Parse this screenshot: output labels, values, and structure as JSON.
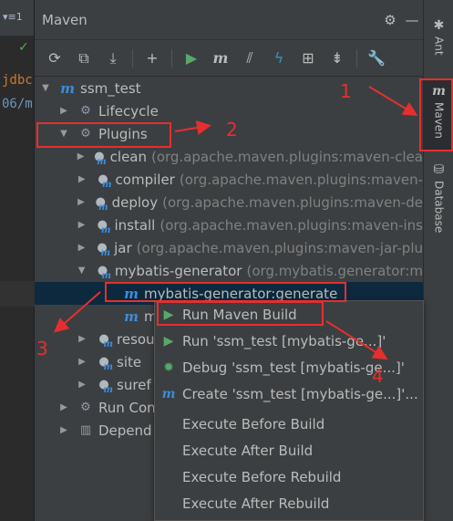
{
  "editor": {
    "top_text": "▾≡1",
    "code_lines": [
      "jdbc",
      "06/m"
    ]
  },
  "panel": {
    "title": "Maven",
    "settings_icon": "gear-icon",
    "hide_icon": "minimize-icon"
  },
  "toolbar": {
    "buttons": [
      {
        "name": "reload-icon",
        "glyph": "⟳"
      },
      {
        "name": "add-folder-icon",
        "glyph": "⧉"
      },
      {
        "name": "download-icon",
        "glyph": "⤓"
      },
      {
        "name": "add-icon",
        "glyph": "+"
      },
      {
        "name": "run-icon",
        "glyph": "▶"
      },
      {
        "name": "maven-goal-icon",
        "glyph": "m"
      },
      {
        "name": "toggle-offline-icon",
        "glyph": "⫽"
      },
      {
        "name": "skip-tests-icon",
        "glyph": "ϟ"
      },
      {
        "name": "show-dependencies-icon",
        "glyph": "⊞"
      },
      {
        "name": "collapse-all-icon",
        "glyph": "⇟"
      },
      {
        "name": "settings-wrench-icon",
        "glyph": "🔧"
      }
    ]
  },
  "tree": {
    "project": "ssm_test",
    "lifecycle": "Lifecycle",
    "plugins": "Plugins",
    "plugin_items": [
      {
        "name": "clean",
        "detail": "(org.apache.maven.plugins:maven-clea"
      },
      {
        "name": "compiler",
        "detail": "(org.apache.maven.plugins:maven-"
      },
      {
        "name": "deploy",
        "detail": "(org.apache.maven.plugins:maven-de"
      },
      {
        "name": "install",
        "detail": "(org.apache.maven.plugins:maven-ins"
      },
      {
        "name": "jar",
        "detail": "(org.apache.maven.plugins:maven-jar-plu"
      },
      {
        "name": "mybatis-generator",
        "detail": "(org.mybatis.generator:m"
      }
    ],
    "goal_selected": "mybatis-generator:generate",
    "goal_second": "m",
    "after_items": [
      {
        "name": "resou",
        "detail": "n"
      },
      {
        "name": "site",
        "detail": "n"
      },
      {
        "name": "suref",
        "detail": ""
      }
    ],
    "run_configs": "Run Con",
    "dependencies": "Depend"
  },
  "right_strip": {
    "tabs": [
      {
        "label": "Ant",
        "icon": "ant-icon"
      },
      {
        "label": "Maven",
        "icon": "maven-icon"
      },
      {
        "label": "Database",
        "icon": "database-icon"
      }
    ]
  },
  "context_menu": {
    "items": [
      {
        "label": "Run Maven Build",
        "icon": "run-icon"
      },
      {
        "label": "Run 'ssm_test [mybatis-ge...]'",
        "icon": "run-icon"
      },
      {
        "label": "Debug 'ssm_test [mybatis-ge...]'",
        "icon": "debug-icon"
      },
      {
        "label": "Create 'ssm_test [mybatis-ge...]'...",
        "icon": "maven-icon"
      },
      {
        "label": "Execute Before Build",
        "icon": ""
      },
      {
        "label": "Execute After Build",
        "icon": ""
      },
      {
        "label": "Execute Before Rebuild",
        "icon": ""
      },
      {
        "label": "Execute After Rebuild",
        "icon": ""
      }
    ]
  },
  "annotations": {
    "labels": [
      "1",
      "2",
      "3",
      "4"
    ],
    "color": "#e52f2f"
  },
  "colors": {
    "panel_bg": "#3c3f41",
    "selection": "#0d293e",
    "maven_blue": "#3a8dde",
    "run_green": "#59a869",
    "annotation_red": "#e52f2f"
  }
}
